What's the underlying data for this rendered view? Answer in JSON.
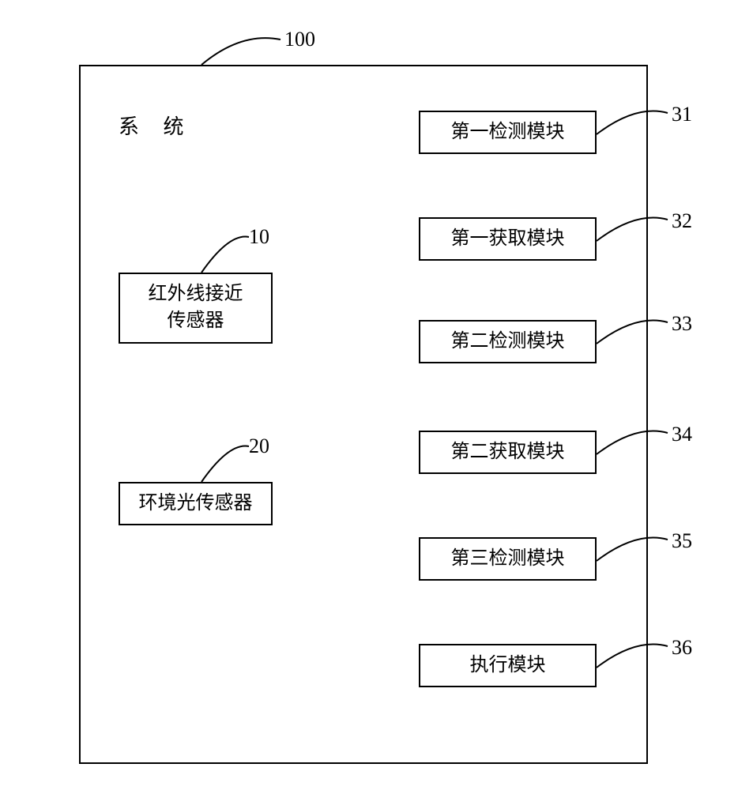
{
  "system": {
    "label": "系 统",
    "callout": "100"
  },
  "sensors": {
    "ir": {
      "label": "红外线接近\n传感器",
      "callout": "10"
    },
    "ambient": {
      "label": "环境光传感器",
      "callout": "20"
    }
  },
  "modules": {
    "m1": {
      "label": "第一检测模块",
      "callout": "31"
    },
    "m2": {
      "label": "第一获取模块",
      "callout": "32"
    },
    "m3": {
      "label": "第二检测模块",
      "callout": "33"
    },
    "m4": {
      "label": "第二获取模块",
      "callout": "34"
    },
    "m5": {
      "label": "第三检测模块",
      "callout": "35"
    },
    "m6": {
      "label": "执行模块",
      "callout": "36"
    }
  }
}
